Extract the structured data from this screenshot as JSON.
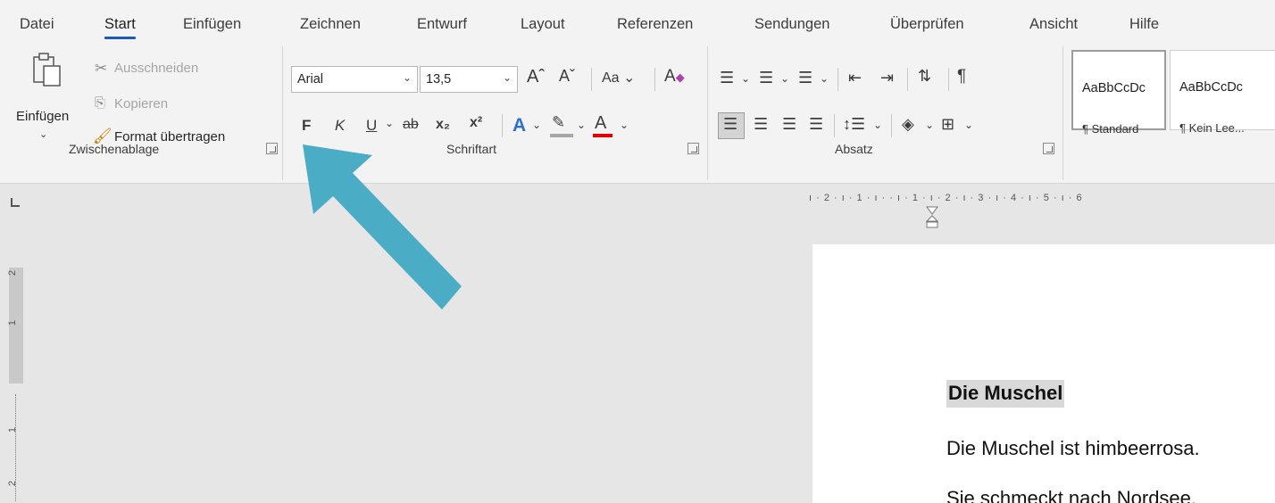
{
  "tabs": [
    "Datei",
    "Start",
    "Einfügen",
    "Zeichnen",
    "Entwurf",
    "Layout",
    "Referenzen",
    "Sendungen",
    "Überprüfen",
    "Ansicht",
    "Hilfe"
  ],
  "active_tab": "Start",
  "clipboard": {
    "paste_label": "Einfügen",
    "cut_label": "Ausschneiden",
    "copy_label": "Kopieren",
    "format_painter_label": "Format übertragen",
    "group_label": "Zwischenablage"
  },
  "font": {
    "font_name": "Arial",
    "font_size": "13,5",
    "bold_label": "F",
    "italic_label": "K",
    "underline_label": "U",
    "strike_label": "ab",
    "subscript_label": "x₂",
    "superscript_label": "x²",
    "change_case_label": "Aa",
    "font_color_label": "A",
    "group_label": "Schriftart",
    "highlight_color": "#a6a6a6",
    "font_color": "#e00000"
  },
  "paragraph": {
    "group_label": "Absatz"
  },
  "styles": [
    {
      "preview": "AaBbCcDc",
      "name": "¶ Standard"
    },
    {
      "preview": "AaBbCcDc",
      "name": "¶ Kein Lee..."
    }
  ],
  "ruler": {
    "horizontal": "ı · 2 · ı · 1 · ı ·    · ı · 1 · ı · 2 · ı · 3 · ı · 4 · ı · 5 · ı · 6",
    "vertical_numbers": [
      "2",
      "1",
      "1",
      "2"
    ]
  },
  "document": {
    "title": "Die Muschel",
    "lines": [
      "Die Muschel ist himbeerrosa.",
      "Sie schmeckt nach Nordsee."
    ]
  },
  "colors": {
    "accent": "#185abd",
    "arrow": "#4bacc6"
  }
}
